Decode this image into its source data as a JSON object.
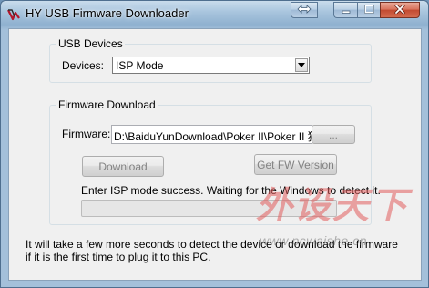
{
  "window": {
    "title": "HY USB Firmware Downloader",
    "icon": "hy-app-icon",
    "captions": {
      "resize_icon": "double-arrow-icon",
      "minimize_icon": "minimize-icon",
      "maximize_icon": "maximize-icon",
      "close_icon": "close-icon"
    }
  },
  "usb_devices": {
    "group_label": "USB Devices",
    "devices_label": "Devices:",
    "selected_device": "ISP Mode"
  },
  "firmware_download": {
    "group_label": "Firmware Download",
    "firmware_label": "Firmware:",
    "firmware_path": "D:\\BaiduYunDownload\\Poker II\\Poker II 独立",
    "browse_label": "...",
    "download_label": "Download",
    "get_fw_version_label": "Get FW Version",
    "status": "Enter ISP mode success. Waiting for the Windows to detect it.",
    "progress": 0
  },
  "note": {
    "line1": "It will take a few more seconds to detect the device or download the firmware",
    "line2": "if it is the first time to plug it to this PC."
  },
  "watermark": {
    "big_text": "外设天下",
    "small_text": "www.pcwaishe.cn"
  },
  "colors": {
    "title_bar": "#a9c5de",
    "client_background": "#f0f0f0",
    "close_button": "#c24a30",
    "disabled_text": "#838383",
    "progress_fill": "#06b025"
  }
}
